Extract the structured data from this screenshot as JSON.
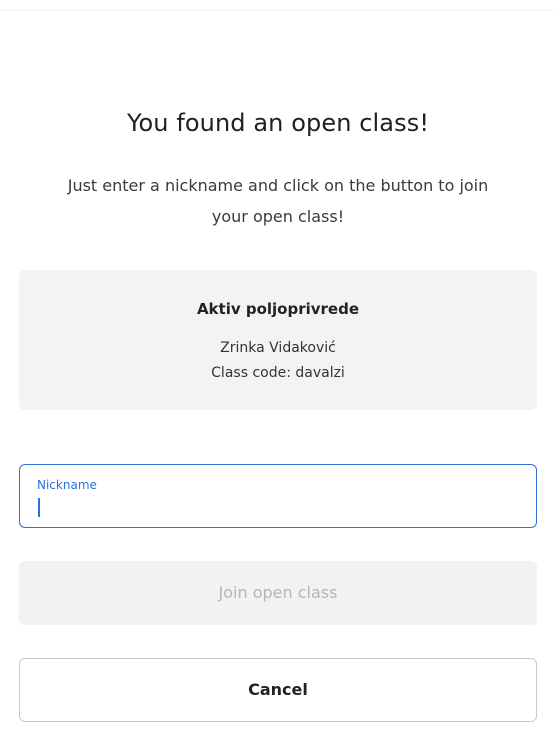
{
  "dialog": {
    "title": "You found an open class!",
    "subtitle_line1": "Just enter a nickname and click on the button to join",
    "subtitle_line2": "your open class!"
  },
  "class_card": {
    "class_name": "Aktiv poljoprivrede",
    "teacher": "Zrinka Vidaković",
    "class_code": "Class code: davalzi"
  },
  "nickname_field": {
    "label": "Nickname",
    "value": ""
  },
  "buttons": {
    "join_label": "Join open class",
    "cancel_label": "Cancel"
  },
  "colors": {
    "accent": "#2e6fd6",
    "card_background": "#f3f3f3",
    "disabled_text": "#b5b5b5"
  }
}
